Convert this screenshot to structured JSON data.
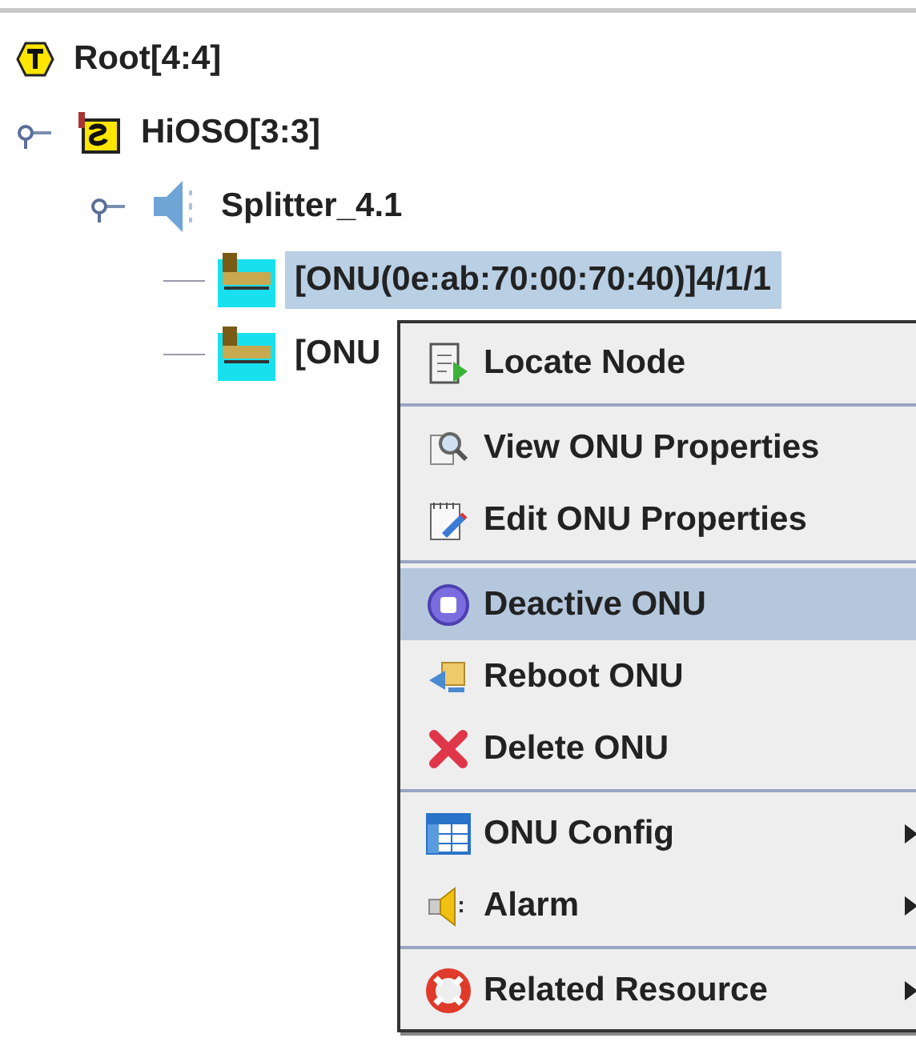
{
  "tree": [
    {
      "label": "Root[4:4]",
      "kind": "root",
      "selected": false,
      "children": [
        {
          "label": "HiOSO[3:3]",
          "kind": "system",
          "selected": false,
          "expanded": true,
          "children": [
            {
              "label": "Splitter_4.1",
              "kind": "splitter",
              "selected": false,
              "expanded": true,
              "children": [
                {
                  "label": "[ONU(0e:ab:70:00:70:40)]4/1/1",
                  "kind": "onu",
                  "selected": true
                },
                {
                  "label": "[ONU",
                  "kind": "onu",
                  "selected": false
                }
              ]
            }
          ]
        }
      ]
    }
  ],
  "context_menu": {
    "groups": [
      [
        {
          "label": "Locate Node",
          "selected": false,
          "submenu": false
        }
      ],
      [
        {
          "label": "View ONU Properties",
          "selected": false,
          "submenu": false
        },
        {
          "label": "Edit ONU Properties",
          "selected": false,
          "submenu": false
        }
      ],
      [
        {
          "label": "Deactive ONU",
          "selected": true,
          "submenu": false
        },
        {
          "label": "Reboot ONU",
          "selected": false,
          "submenu": false
        },
        {
          "label": "Delete ONU",
          "selected": false,
          "submenu": false
        }
      ],
      [
        {
          "label": "ONU Config",
          "selected": false,
          "submenu": true
        },
        {
          "label": "Alarm",
          "selected": false,
          "submenu": true
        }
      ],
      [
        {
          "label": "Related Resource",
          "selected": false,
          "submenu": true
        }
      ]
    ]
  }
}
